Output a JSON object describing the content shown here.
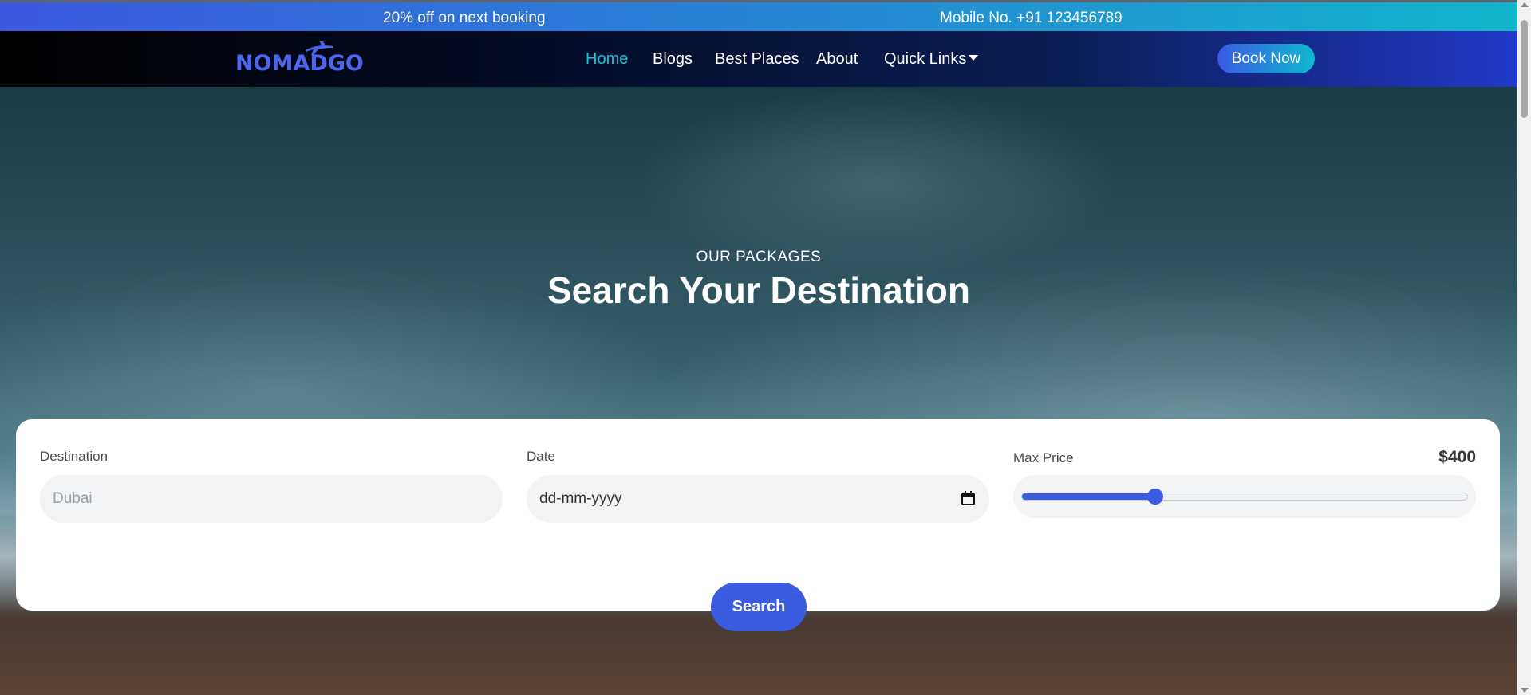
{
  "topbar": {
    "promo": "20% off on next booking",
    "phone": "Mobile No. +91 123456789"
  },
  "navbar": {
    "logo": "NOMADGO",
    "links": [
      "Home",
      "Blogs",
      "Best Places",
      "About",
      "Quick Links"
    ],
    "active": "Home",
    "book_now": "Book Now"
  },
  "hero": {
    "eyebrow": "OUR PACKAGES",
    "title": "Search Your Destination"
  },
  "search_form": {
    "destination_label": "Destination",
    "destination_placeholder": "Dubai",
    "date_label": "Date",
    "date_placeholder": "dd-mm-yyyy",
    "price_label": "Max Price",
    "price_value": "$400",
    "price_fraction": 0.3,
    "search_button": "Search"
  },
  "colors": {
    "accent": "#3b5be0",
    "active_link": "#18c4d8"
  },
  "icons": {
    "logo": "airplane-icon",
    "dropdown": "caret-down-icon",
    "date": "calendar-icon"
  }
}
